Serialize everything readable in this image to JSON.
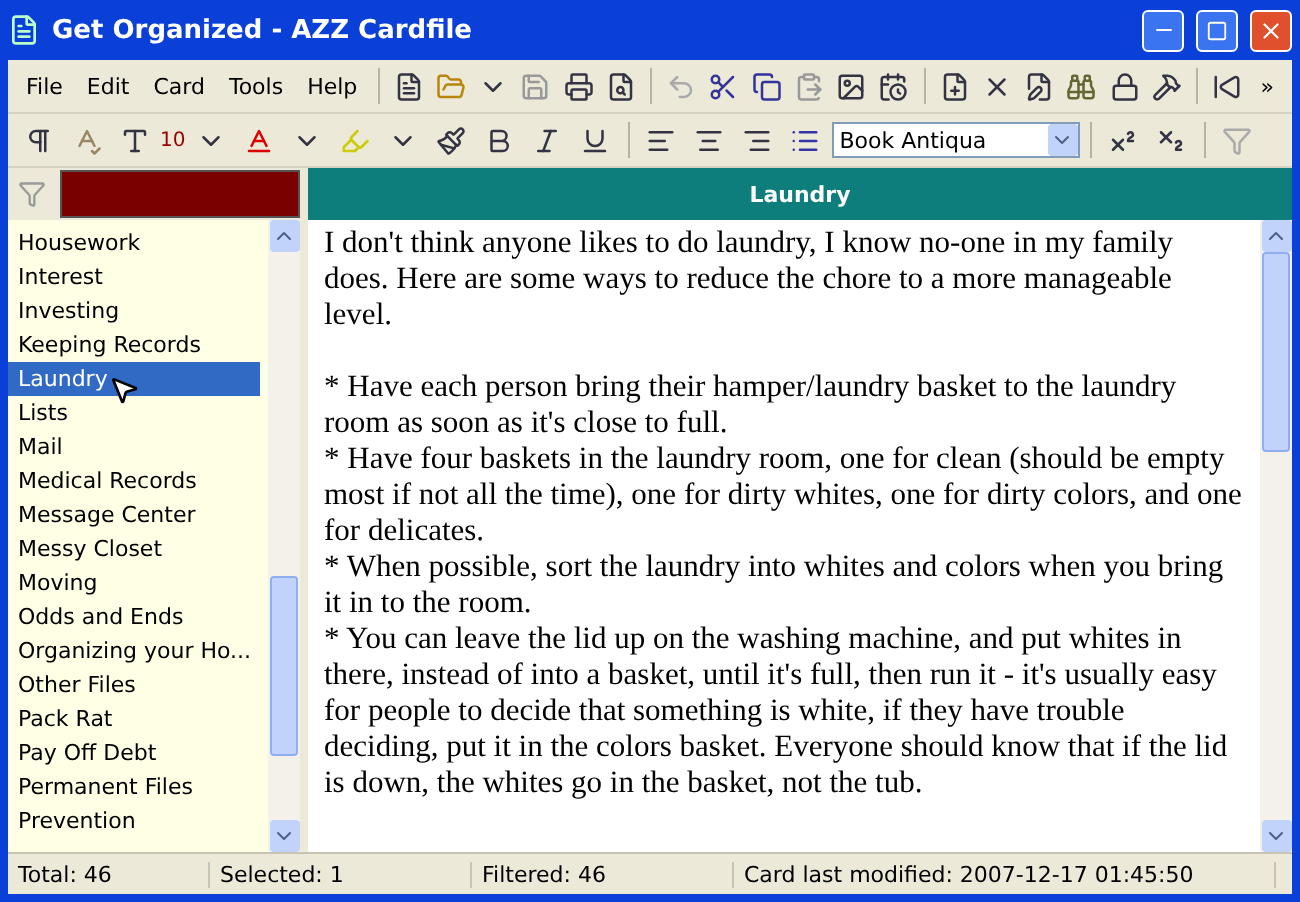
{
  "window": {
    "title": "Get Organized - AZZ Cardfile"
  },
  "menu": [
    "File",
    "Edit",
    "Card",
    "Tools",
    "Help"
  ],
  "toolbar": {
    "overflow": "»",
    "font_size": "10",
    "font_name": "Book Antiqua"
  },
  "sidebar": {
    "items": [
      {
        "label": "Housework",
        "selected": false
      },
      {
        "label": "Interest",
        "selected": false
      },
      {
        "label": "Investing",
        "selected": false
      },
      {
        "label": "Keeping Records",
        "selected": false
      },
      {
        "label": "Laundry",
        "selected": true
      },
      {
        "label": "Lists",
        "selected": false
      },
      {
        "label": "Mail",
        "selected": false
      },
      {
        "label": "Medical Records",
        "selected": false
      },
      {
        "label": "Message Center",
        "selected": false
      },
      {
        "label": "Messy Closet",
        "selected": false
      },
      {
        "label": "Moving",
        "selected": false
      },
      {
        "label": "Odds and Ends",
        "selected": false
      },
      {
        "label": "Organizing your Ho...",
        "selected": false
      },
      {
        "label": "Other Files",
        "selected": false
      },
      {
        "label": "Pack Rat",
        "selected": false
      },
      {
        "label": "Pay Off Debt",
        "selected": false
      },
      {
        "label": "Permanent Files",
        "selected": false
      },
      {
        "label": "Prevention",
        "selected": false
      }
    ]
  },
  "card": {
    "title": "Laundry",
    "intro": "I don't think anyone likes to do laundry, I know no-one in my family does. Here are some ways to reduce the chore to a more manageable level.",
    "tips": [
      "* Have each person bring their hamper/laundry basket to the laundry room as soon as it's close to full.",
      "* Have four baskets in the laundry room, one for clean (should be empty most if not all the time), one for dirty whites, one for dirty colors, and one for delicates.",
      "* When possible, sort the laundry into whites and colors when you bring it in to the room.",
      "* You can leave the lid up on the washing machine, and put whites in there, instead of into a basket, until it's full, then run it - it's usually easy for people to decide that something is white, if they have trouble deciding, put it in the colors basket. Everyone should know that if the lid is down, the whites go in the basket, not the tub."
    ]
  },
  "status_bar": [
    "Total: 46",
    "Selected: 1",
    "Filtered: 46",
    "Card last modified: 2007-12-17  01:45:50"
  ]
}
